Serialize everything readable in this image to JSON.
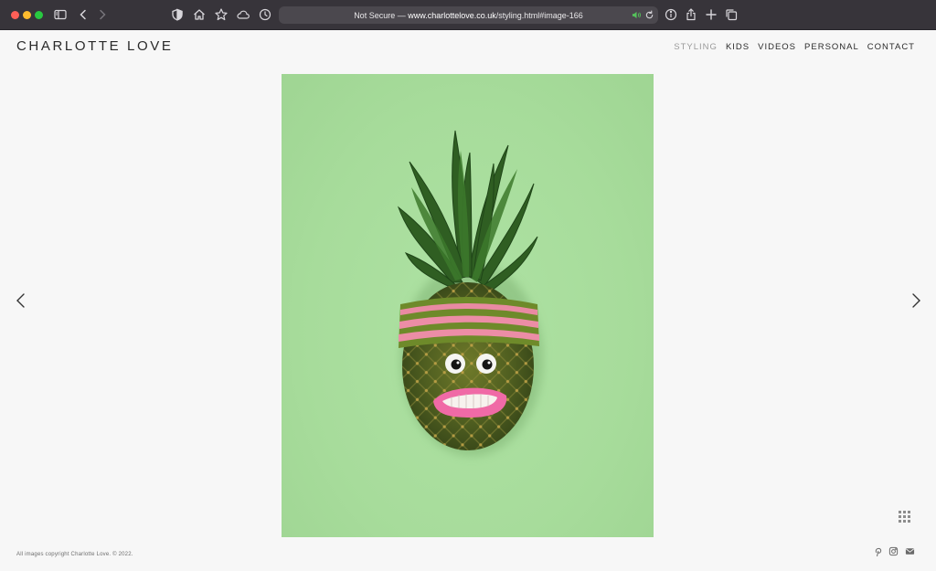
{
  "browser": {
    "url_prefix": "Not Secure — ",
    "url_host": "www.charlottelove.co.uk",
    "url_path": "/styling.html#image-166",
    "icons": [
      "sidebar-icon",
      "back-icon",
      "forward-icon",
      "shield-icon",
      "home-icon",
      "star-icon",
      "cloud-icon",
      "history-icon",
      "speaker-icon",
      "reload-icon",
      "info-icon",
      "share-icon",
      "new-tab-icon",
      "tabs-overview-icon"
    ]
  },
  "site": {
    "title": "CHARLOTTE LOVE",
    "nav": [
      {
        "label": "STYLING",
        "active": true
      },
      {
        "label": "KIDS",
        "active": false
      },
      {
        "label": "VIDEOS",
        "active": false
      },
      {
        "label": "PERSONAL",
        "active": false
      },
      {
        "label": "CONTACT",
        "active": false
      }
    ]
  },
  "gallery": {
    "background_color": "#a9dd9d",
    "controls": [
      "prev-arrow-icon",
      "next-arrow-icon",
      "grid-view-icon"
    ]
  },
  "footer": {
    "copyright": "All images copyright Charlotte Love. © 2022.",
    "social_icons": [
      "pinterest-icon",
      "instagram-icon",
      "mail-icon"
    ]
  }
}
